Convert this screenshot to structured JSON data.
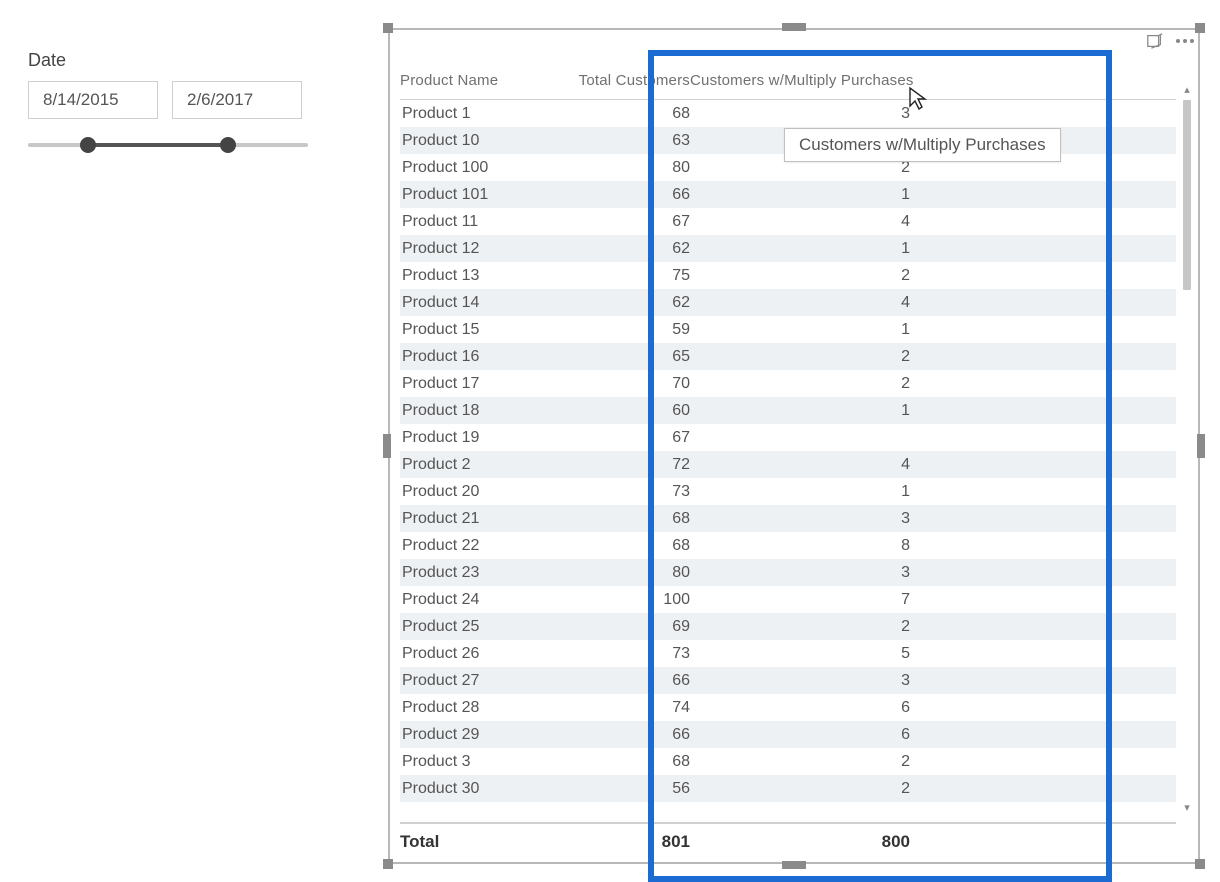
{
  "slicer": {
    "title": "Date",
    "start": "8/14/2015",
    "end": "2/6/2017"
  },
  "tooltip": "Customers w/Multiply Purchases",
  "table": {
    "columns": [
      "Product Name",
      "Total Customers",
      "Customers w/Multiply Purchases"
    ],
    "rows": [
      {
        "name": "Product 1",
        "total": "68",
        "multi": "3"
      },
      {
        "name": "Product 10",
        "total": "63",
        "multi": ""
      },
      {
        "name": "Product 100",
        "total": "80",
        "multi": "2"
      },
      {
        "name": "Product 101",
        "total": "66",
        "multi": "1"
      },
      {
        "name": "Product 11",
        "total": "67",
        "multi": "4"
      },
      {
        "name": "Product 12",
        "total": "62",
        "multi": "1"
      },
      {
        "name": "Product 13",
        "total": "75",
        "multi": "2"
      },
      {
        "name": "Product 14",
        "total": "62",
        "multi": "4"
      },
      {
        "name": "Product 15",
        "total": "59",
        "multi": "1"
      },
      {
        "name": "Product 16",
        "total": "65",
        "multi": "2"
      },
      {
        "name": "Product 17",
        "total": "70",
        "multi": "2"
      },
      {
        "name": "Product 18",
        "total": "60",
        "multi": "1"
      },
      {
        "name": "Product 19",
        "total": "67",
        "multi": ""
      },
      {
        "name": "Product 2",
        "total": "72",
        "multi": "4"
      },
      {
        "name": "Product 20",
        "total": "73",
        "multi": "1"
      },
      {
        "name": "Product 21",
        "total": "68",
        "multi": "3"
      },
      {
        "name": "Product 22",
        "total": "68",
        "multi": "8"
      },
      {
        "name": "Product 23",
        "total": "80",
        "multi": "3"
      },
      {
        "name": "Product 24",
        "total": "100",
        "multi": "7"
      },
      {
        "name": "Product 25",
        "total": "69",
        "multi": "2"
      },
      {
        "name": "Product 26",
        "total": "73",
        "multi": "5"
      },
      {
        "name": "Product 27",
        "total": "66",
        "multi": "3"
      },
      {
        "name": "Product 28",
        "total": "74",
        "multi": "6"
      },
      {
        "name": "Product 29",
        "total": "66",
        "multi": "6"
      },
      {
        "name": "Product 3",
        "total": "68",
        "multi": "2"
      },
      {
        "name": "Product 30",
        "total": "56",
        "multi": "2"
      }
    ],
    "total": {
      "label": "Total",
      "total": "801",
      "multi": "800"
    }
  }
}
